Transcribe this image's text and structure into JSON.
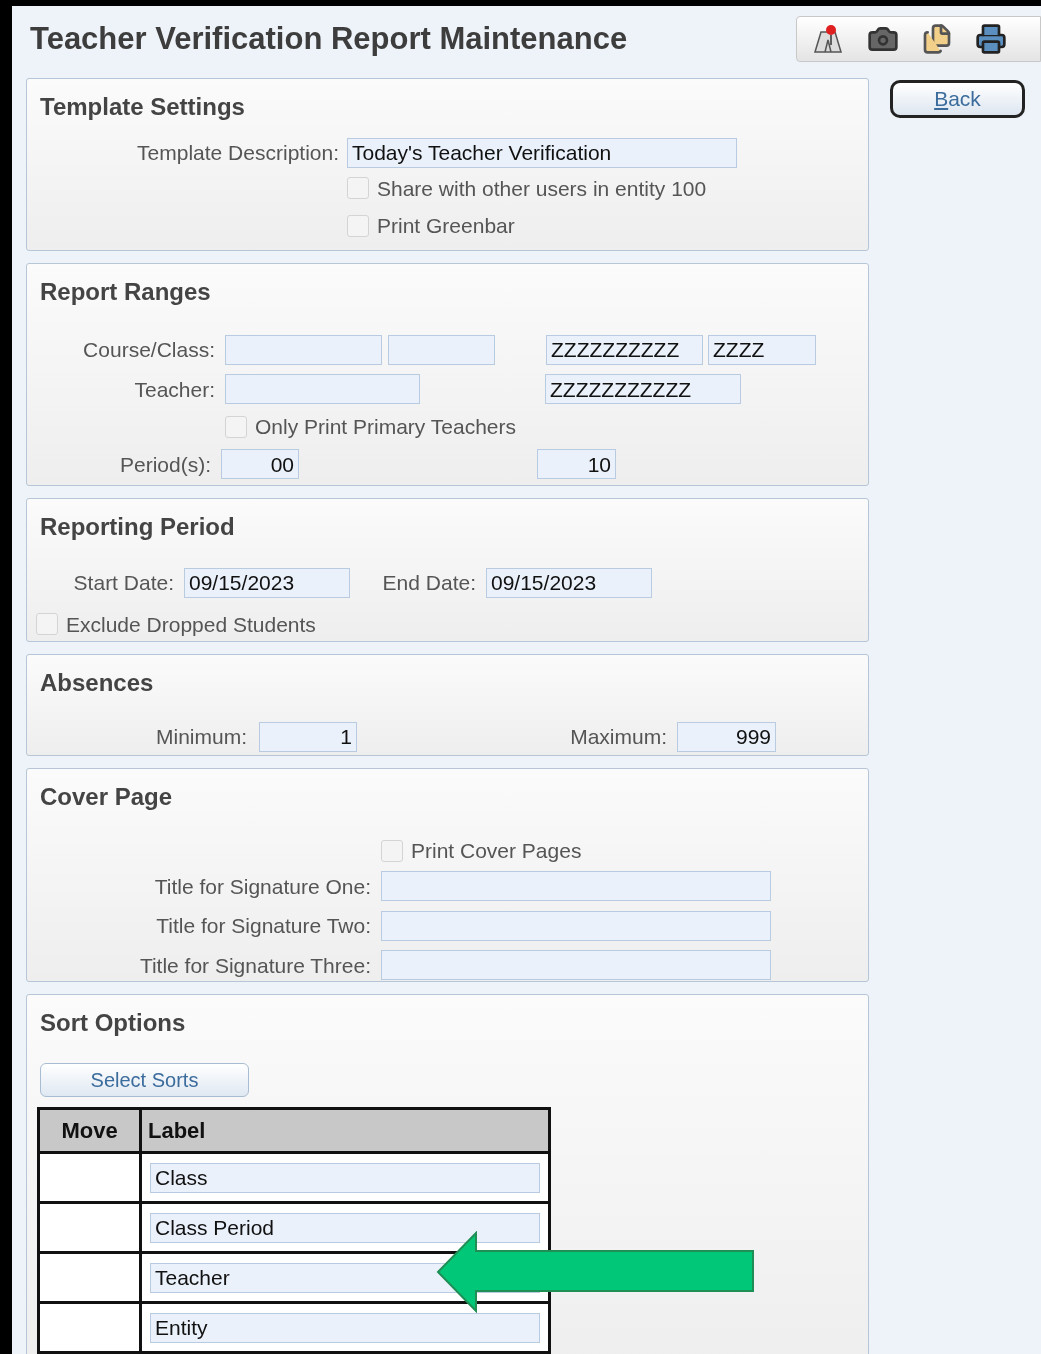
{
  "page_title": "Teacher Verification Report Maintenance",
  "back_button": {
    "label": "Back"
  },
  "template_settings": {
    "title": "Template Settings",
    "description_label": "Template Description:",
    "description_value": "Today's Teacher Verification",
    "options": [
      {
        "label": "Share with other users in entity 100",
        "checked": false
      },
      {
        "label": "Print Greenbar",
        "checked": false
      }
    ]
  },
  "report_ranges": {
    "title": "Report Ranges",
    "course_label": "Course/Class:",
    "course_to": [
      "ZZZZZZZZZZ",
      "ZZZZ"
    ],
    "teacher_label": "Teacher:",
    "teacher_to": "ZZZZZZZZZZZ",
    "primary_option": {
      "label": "Only Print Primary Teachers",
      "checked": false
    },
    "period_label": "Period(s):",
    "period_from": "00",
    "period_to": "10"
  },
  "reporting_period": {
    "title": "Reporting Period",
    "start_label": "Start Date:",
    "start_value": "09/15/2023",
    "end_label": "End Date:",
    "end_value": "09/15/2023",
    "exclude_option": {
      "label": "Exclude Dropped Students",
      "checked": false
    }
  },
  "absences": {
    "title": "Absences",
    "minimum_label": "Minimum:",
    "minimum_value": "1",
    "maximum_label": "Maximum:",
    "maximum_value": "999"
  },
  "cover_page": {
    "title": "Cover Page",
    "print_option": {
      "label": "Print Cover Pages",
      "checked": false
    },
    "signatures": [
      {
        "label": "Title for Signature One:"
      },
      {
        "label": "Title for Signature Two:"
      },
      {
        "label": "Title for Signature Three:"
      }
    ]
  },
  "sort_options": {
    "title": "Sort Options",
    "button": "Select Sorts",
    "columns": [
      "Move",
      "Label"
    ],
    "rows": [
      {
        "label": "Class"
      },
      {
        "label": "Class Period"
      },
      {
        "label": "Teacher"
      },
      {
        "label": "Entity"
      }
    ]
  }
}
